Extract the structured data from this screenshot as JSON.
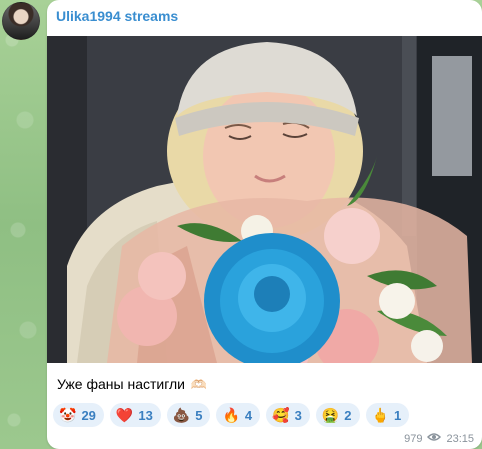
{
  "message": {
    "channel_name": "Ulika1994 streams",
    "caption_text": "Уже фаны настигли",
    "caption_emoji": "🫶🏻",
    "views": "979",
    "time": "23:15"
  },
  "reactions": [
    {
      "emoji": "🤡",
      "count": "29"
    },
    {
      "emoji": "❤️",
      "count": "13"
    },
    {
      "emoji": "💩",
      "count": "5"
    },
    {
      "emoji": "🔥",
      "count": "4"
    },
    {
      "emoji": "🥰",
      "count": "3"
    },
    {
      "emoji": "🤮",
      "count": "2"
    },
    {
      "emoji": "🖕",
      "count": "1"
    }
  ],
  "colors": {
    "channel_name": "#3a8ed0",
    "reaction_bg": "#e6f0fa",
    "reaction_text": "#3a7fc0",
    "meta_text": "#8a939c"
  },
  "icons": {
    "views": "eye-icon"
  }
}
